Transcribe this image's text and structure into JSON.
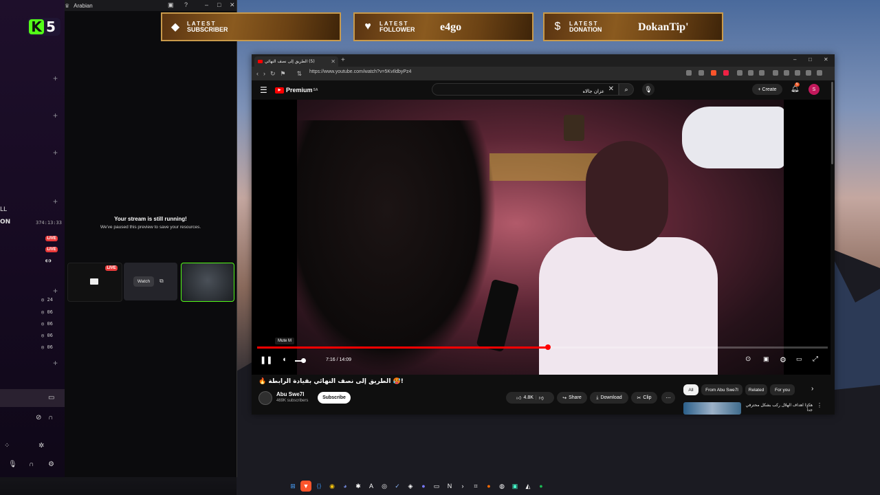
{
  "stream_app": {
    "logo_number": "5",
    "window_title": "Arabian",
    "timer": "374:13:33",
    "side_text_1": "LL",
    "side_text_2": "ON",
    "live_label": "LIVE",
    "row_counts": [
      "24",
      "06",
      "06",
      "06",
      "06"
    ],
    "paused_title": "Your stream is still running!",
    "paused_subtitle": "We've paused this preview to save your resources.",
    "watch_label": "Watch"
  },
  "alerts": [
    {
      "line1": "LATEST",
      "line2": "SUBSCRIBER",
      "name": "",
      "icon": "diamond-icon"
    },
    {
      "line1": "LATEST",
      "line2": "FOLLOWER",
      "name": "e4go",
      "icon": "heart-icon"
    },
    {
      "line1": "LATEST",
      "line2": "DONATION",
      "name": "DokanTip'",
      "icon": "dollar-icon"
    }
  ],
  "browser": {
    "tab_title": "(5) الطريق إلى نصف النهائي",
    "url": "https://www.youtube.com/watch?v=5KvIldbyPz4"
  },
  "youtube": {
    "logo_text": "Premium",
    "logo_region": "SA",
    "search_value": "عزان جالاه",
    "create_label": "Create",
    "notification_count": "5",
    "avatar_letter": "S",
    "player": {
      "tooltip": "Mute  M",
      "time": "7:16 / 14:09",
      "progress": 0.51
    },
    "video_title": "!🥵 الطريق إلى نصف النهائي بقيادة الرابطة 🔥",
    "channel_name": "Abu Swe7l",
    "channel_subs": "469K subscribers",
    "subscribe_label": "Subscribe",
    "likes": "4.8K",
    "share_label": "Share",
    "download_label": "Download",
    "clip_label": "Clip",
    "chips": [
      "All",
      "From Abu Swe7l",
      "Related",
      "For you"
    ],
    "rec_text": "هكذا اهداف الهلال ركب بشكل محترفي جداً"
  },
  "colors": {
    "kick_green": "#53fc18",
    "youtube_red": "#ff0000",
    "alert_gold": "#c99a4b"
  }
}
